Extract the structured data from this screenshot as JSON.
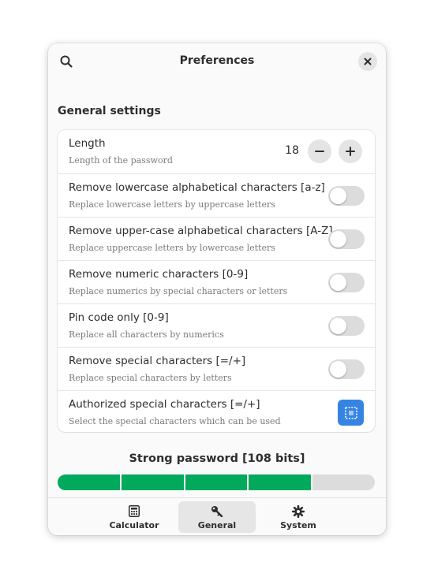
{
  "header": {
    "title": "Preferences",
    "search_icon": "search-icon",
    "close_icon": "close-icon"
  },
  "general": {
    "section_title": "General settings",
    "length": {
      "title": "Length",
      "subtitle": "Length of the password",
      "value": "18"
    },
    "toggles": [
      {
        "title": "Remove lowercase alphabetical characters [a-z]",
        "subtitle": "Replace lowercase letters by uppercase letters",
        "on": false
      },
      {
        "title": "Remove upper-case alphabetical characters [A-Z]",
        "subtitle": "Replace uppercase letters by lowercase letters",
        "on": false
      },
      {
        "title": "Remove numeric characters [0-9]",
        "subtitle": "Replace numerics by special characters or letters",
        "on": false
      },
      {
        "title": "Pin code only [0-9]",
        "subtitle": "Replace all characters by numerics",
        "on": false
      },
      {
        "title": "Remove special characters [=/+]",
        "subtitle": "Replace special characters by letters",
        "on": false
      }
    ],
    "authorized": {
      "title": "Authorized special characters [=/+]",
      "subtitle": "Select the special characters which can be used",
      "icon": "selection-icon"
    }
  },
  "strength": {
    "label": "Strong password [108 bits]",
    "segments_total": 5,
    "segments_filled": 4,
    "fill_color": "#00a95c",
    "empty_color": "#dcdcdc"
  },
  "tabs": [
    {
      "label": "Calculator",
      "icon": "calculator-icon",
      "active": false
    },
    {
      "label": "General",
      "icon": "key-icon",
      "active": true
    },
    {
      "label": "System",
      "icon": "gear-icon",
      "active": false
    }
  ],
  "colors": {
    "accent": "#3584e4",
    "success": "#00a95c"
  }
}
